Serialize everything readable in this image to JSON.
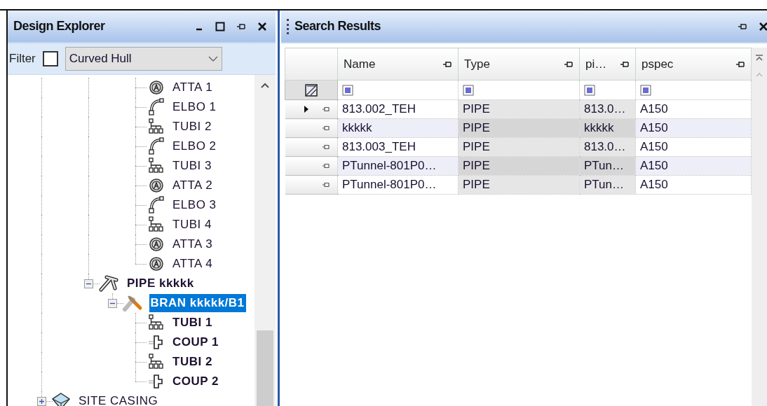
{
  "left_panel": {
    "title": "Design Explorer",
    "filter": {
      "label": "Filter",
      "checked": false,
      "value": "Curved Hull"
    },
    "tree": [
      {
        "children": [
          {
            "children": [
              {
                "children": [
                  {
                    "children": [
                      {
                        "label": "ATTA 1",
                        "kind": "atta",
                        "bold": false,
                        "selected": false
                      },
                      {
                        "label": "ELBO 1",
                        "kind": "elbo",
                        "bold": false,
                        "selected": false
                      },
                      {
                        "label": "TUBI 2",
                        "kind": "tubi",
                        "bold": false,
                        "selected": false
                      },
                      {
                        "label": "ELBO 2",
                        "kind": "elbo",
                        "bold": false,
                        "selected": false
                      },
                      {
                        "label": "TUBI 3",
                        "kind": "tubi",
                        "bold": false,
                        "selected": false
                      },
                      {
                        "label": "ATTA 2",
                        "kind": "atta",
                        "bold": false,
                        "selected": false
                      },
                      {
                        "label": "ELBO 3",
                        "kind": "elbo",
                        "bold": false,
                        "selected": false
                      },
                      {
                        "label": "TUBI 4",
                        "kind": "tubi",
                        "bold": false,
                        "selected": false
                      },
                      {
                        "label": "ATTA 3",
                        "kind": "atta",
                        "bold": false,
                        "selected": false
                      },
                      {
                        "label": "ATTA 4",
                        "kind": "atta",
                        "bold": false,
                        "selected": false
                      }
                    ]
                  }
                ]
              },
              {
                "label": "PIPE kkkkk",
                "kind": "pipe",
                "bold": true,
                "selected": false,
                "expanded": true,
                "children": [
                  {
                    "label": "BRAN kkkkk/B1",
                    "kind": "bran",
                    "bold": true,
                    "selected": true,
                    "expanded": true,
                    "children": [
                      {
                        "label": "TUBI 1",
                        "kind": "tubi",
                        "bold": true,
                        "selected": false
                      },
                      {
                        "label": "COUP 1",
                        "kind": "coup",
                        "bold": true,
                        "selected": false
                      },
                      {
                        "label": "TUBI 2",
                        "kind": "tubi",
                        "bold": true,
                        "selected": false
                      },
                      {
                        "label": "COUP 2",
                        "kind": "coup",
                        "bold": true,
                        "selected": false
                      }
                    ]
                  }
                ]
              }
            ]
          }
        ]
      },
      {
        "label": "SITE CASING",
        "kind": "site",
        "bold": false,
        "selected": false,
        "expanded": false
      }
    ]
  },
  "right_panel": {
    "title": "Search Results",
    "table": {
      "columns": [
        "Name",
        "Type",
        "pi…",
        "pspec"
      ],
      "rows": [
        {
          "current": true,
          "cells": [
            "813.002_TEH",
            "PIPE",
            "813.0…",
            "A150"
          ]
        },
        {
          "current": false,
          "cells": [
            "kkkkk",
            "PIPE",
            "kkkkk",
            "A150"
          ]
        },
        {
          "current": false,
          "cells": [
            "813.003_TEH",
            "PIPE",
            "813.0…",
            "A150"
          ]
        },
        {
          "current": false,
          "cells": [
            "PTunnel-801P0…",
            "PIPE",
            "PTun…",
            "A150"
          ]
        },
        {
          "current": false,
          "cells": [
            "PTunnel-801P0…",
            "PIPE",
            "PTun…",
            "A150"
          ]
        }
      ]
    }
  }
}
